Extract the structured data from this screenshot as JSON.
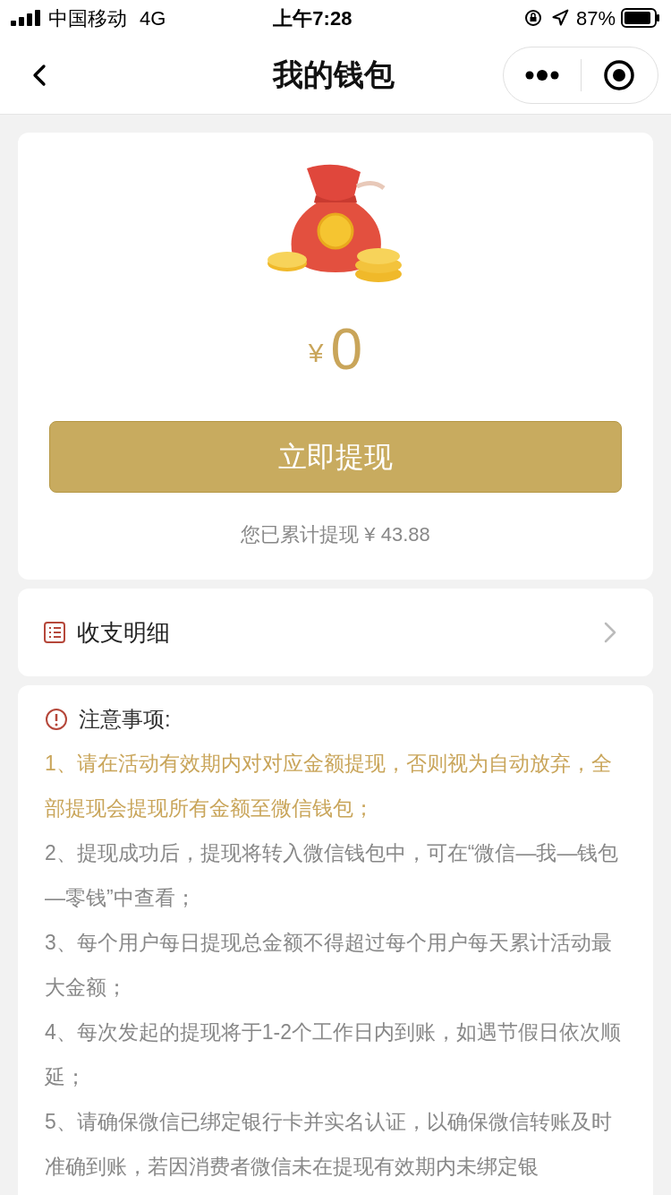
{
  "status_bar": {
    "carrier": "中国移动",
    "network": "4G",
    "time": "上午7:28",
    "battery": "87%"
  },
  "nav": {
    "title": "我的钱包"
  },
  "wallet": {
    "currency": "¥",
    "amount": "0",
    "button": "立即提现",
    "total": "您已累计提现 ¥ 43.88"
  },
  "details": {
    "label": "收支明细"
  },
  "notice": {
    "title": "注意事项:",
    "items": [
      {
        "text": "1、请在活动有效期内对对应金额提现，否则视为自动放弃，全部提现会提现所有金额至微信钱包；",
        "highlighted": true
      },
      {
        "text": "2、提现成功后，提现将转入微信钱包中，可在“微信—我—钱包—零钱”中查看；",
        "highlighted": false
      },
      {
        "text": "3、每个用户每日提现总金额不得超过每个用户每天累计活动最大金额；",
        "highlighted": false
      },
      {
        "text": "4、每次发起的提现将于1-2个工作日内到账，如遇节假日依次顺延；",
        "highlighted": false
      },
      {
        "text": "5、请确保微信已绑定银行卡并实名认证，以确保微信转账及时准确到账，若因消费者微信未在提现有效期内未绑定银",
        "highlighted": false
      }
    ]
  }
}
